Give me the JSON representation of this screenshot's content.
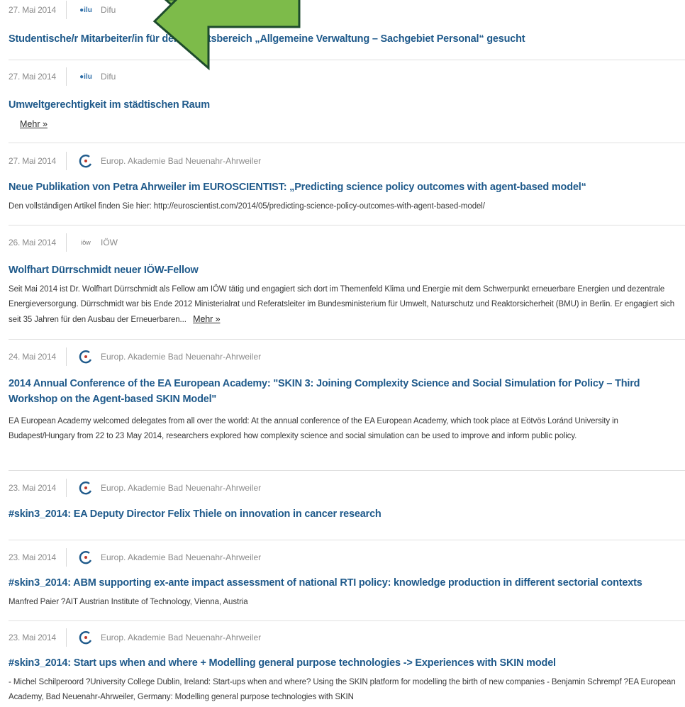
{
  "colors": {
    "title": "#1f5a8b",
    "meta": "#8a8a8a",
    "arrow_fill": "#7dbb4a",
    "arrow_stroke": "#1d4b2c"
  },
  "items": [
    {
      "date": "27. Mai 2014",
      "logo": "difu-logo",
      "logo_text": "●ilu",
      "source": "Difu",
      "title": "Studentische/r Mitarbeiter/in für den Arbeitsbereich „Allgemeine Verwaltung – Sachgebiet Personal“ gesucht"
    },
    {
      "date": "27. Mai 2014",
      "logo": "difu-logo",
      "logo_text": "●ilu",
      "source": "Difu",
      "title": "Umweltgerechtigkeit im städtischen Raum",
      "more": "Mehr »"
    },
    {
      "date": "27. Mai 2014",
      "logo": "ea-logo",
      "source": "Europ. Akademie Bad Neuenahr-Ahrweiler",
      "title": "Neue Publikation von Petra Ahrweiler im EUROSCIENTIST: „Predicting science policy outcomes with agent-based model“",
      "desc": "Den vollständigen Artikel finden Sie hier: http://euroscientist.com/2014/05/predicting-science-policy-outcomes-with-agent-based-model/"
    },
    {
      "date": "26. Mai 2014",
      "logo": "ioew-logo",
      "logo_text": "iöw",
      "source": "IÖW",
      "title": "Wolfhart Dürrschmidt neuer IÖW-Fellow",
      "desc": "Seit Mai 2014 ist Dr. Wolfhart Dürrschmidt als Fellow am IÖW tätig und engagiert sich dort im Themenfeld Klima und Energie mit dem Schwerpunkt erneuerbare Energien und dezentrale Energieversorgung. Dürrschmidt war bis Ende 2012 Ministerialrat und Referatsleiter im Bundesministerium für Umwelt, Naturschutz und Reaktorsicherheit (BMU) in Berlin. Er engagiert sich seit 35 Jahren für den Ausbau der Erneuerbaren...",
      "more": "Mehr »"
    },
    {
      "date": "24. Mai 2014",
      "logo": "ea-logo",
      "source": "Europ. Akademie Bad Neuenahr-Ahrweiler",
      "title": "2014 Annual Conference of the EA European Academy: \"SKIN 3: Joining Complexity Science and Social Simulation for Policy – Third Workshop on the Agent-based SKIN Model\"",
      "desc": "EA European Academy welcomed delegates from all over the world: At the annual conference of the EA European Academy, which took place at Eötvös Loránd University in Budapest/Hungary from 22 to 23 May 2014, researchers explored how complexity science and social simulation can be used to improve and inform public policy."
    },
    {
      "date": "23. Mai 2014",
      "logo": "ea-logo",
      "source": "Europ. Akademie Bad Neuenahr-Ahrweiler",
      "title": "#skin3_2014: EA Deputy Director Felix Thiele on innovation in cancer research"
    },
    {
      "date": "23. Mai 2014",
      "logo": "ea-logo",
      "source": "Europ. Akademie Bad Neuenahr-Ahrweiler",
      "title": "#skin3_2014: ABM supporting ex-ante impact assessment of national RTI policy: knowledge production in different sectorial contexts",
      "desc": "Manfred Paier ?AIT Austrian Institute of Technology, Vienna, Austria"
    },
    {
      "date": "23. Mai 2014",
      "logo": "ea-logo",
      "source": "Europ. Akademie Bad Neuenahr-Ahrweiler",
      "title": "#skin3_2014: Start ups when and where + Modelling general purpose technologies -> Experiences with SKIN model",
      "desc": "- Michel Schilperoord ?University College Dublin, Ireland: Start-ups when and where? Using the SKIN platform for modelling the birth of new companies - Benjamin Schrempf ?EA European Academy, Bad Neuenahr-Ahrweiler, Germany: Modelling general purpose technologies with SKIN"
    }
  ]
}
